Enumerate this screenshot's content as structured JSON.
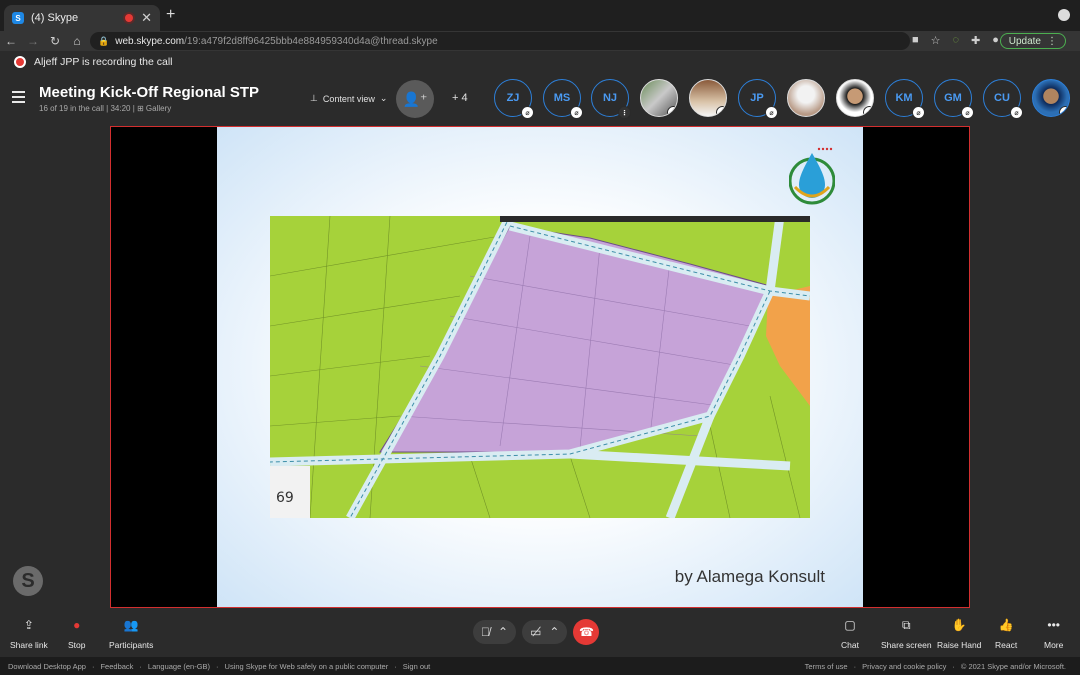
{
  "browser": {
    "tab_title": "(4) Skype",
    "url_host": "web.skype.com",
    "url_path": "/19:a479f2d8ff96425bbb4e884959340d4a@thread.skype",
    "update_label": "Update"
  },
  "recording": {
    "text": "Aljeff JPP is recording the call"
  },
  "meeting": {
    "title": "Meeting Kick-Off Regional STP",
    "subtitle": "16 of 19 in the call | 34:20 | ⊞ Gallery",
    "content_view": "Content view",
    "extra_count": "+ 4"
  },
  "participants": [
    {
      "initials": "ZJ"
    },
    {
      "initials": "MS"
    },
    {
      "initials": "NJ"
    },
    {
      "initials": "JP"
    },
    {
      "initials": "KM"
    },
    {
      "initials": "GM"
    },
    {
      "initials": "CU"
    }
  ],
  "slide": {
    "credit": "by Alamega Konsult",
    "map_corner_number": "69"
  },
  "toolbar": {
    "share_link": "Share link",
    "stop": "Stop",
    "participants": "Participants",
    "chat": "Chat",
    "share_screen": "Share screen",
    "raise_hand": "Raise Hand",
    "react": "React",
    "more": "More"
  },
  "footer": {
    "download": "Download Desktop App",
    "feedback": "Feedback",
    "language": "Language (en-GB)",
    "safety": "Using Skype for Web safely on a public computer",
    "signout": "Sign out",
    "terms": "Terms of use",
    "privacy": "Privacy and cookie policy",
    "copyright": "© 2021 Skype and/or Microsoft."
  },
  "colors": {
    "accent": "#2d7fd8",
    "record": "#e53935",
    "stage_border": "#d32f2f"
  }
}
